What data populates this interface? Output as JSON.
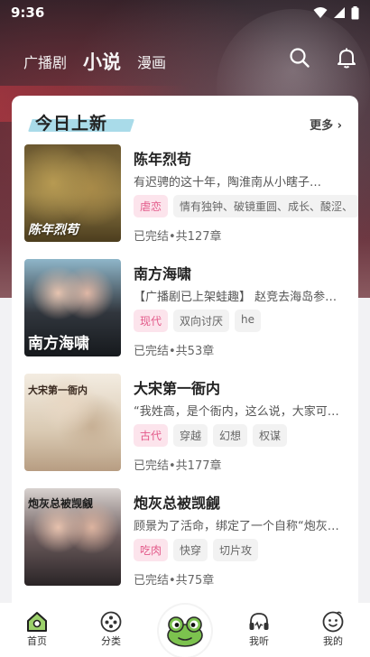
{
  "status_bar": {
    "time": "9:36"
  },
  "top_nav": {
    "tabs": [
      {
        "label": "广播剧",
        "active": false
      },
      {
        "label": "小说",
        "active": true
      },
      {
        "label": "漫画",
        "active": false
      }
    ],
    "icons": [
      "search-icon",
      "bell-icon"
    ]
  },
  "section": {
    "title": "今日上新",
    "more_label": "更多",
    "accent": "#a9dbe9"
  },
  "books": [
    {
      "title": "陈年烈苟",
      "description": "有迟骋的这十年，陶淮南从小瞎子…",
      "tags": [
        {
          "label": "虐恋",
          "highlight": true
        },
        {
          "label": "情有独钟、破镜重圆、成长、酸涩、",
          "highlight": false
        }
      ],
      "meta": "已完结•共127章",
      "cover_text": "陈年烈苟"
    },
    {
      "title": "南方海啸",
      "description": "【广播剧已上架蛙趣】 赵竞去海岛参…",
      "tags": [
        {
          "label": "现代",
          "highlight": true
        },
        {
          "label": "双向讨厌",
          "highlight": false
        },
        {
          "label": "he",
          "highlight": false
        }
      ],
      "meta": "已完结•共53章",
      "cover_text": "南方海啸"
    },
    {
      "title": "大宋第一衙内",
      "description": "“我姓高，是个衙内，这么说，大家可…",
      "tags": [
        {
          "label": "古代",
          "highlight": true
        },
        {
          "label": "穿越",
          "highlight": false
        },
        {
          "label": "幻想",
          "highlight": false
        },
        {
          "label": "权谋",
          "highlight": false
        }
      ],
      "meta": "已完结•共177章",
      "cover_text": "大宋第一衙内"
    },
    {
      "title": "炮灰总被觊觎",
      "description": "顾景为了活命，绑定了一个自称“炮灰…",
      "tags": [
        {
          "label": "吃肉",
          "highlight": true
        },
        {
          "label": "快穿",
          "highlight": false
        },
        {
          "label": "切片攻",
          "highlight": false
        }
      ],
      "meta": "已完结•共75章",
      "cover_text": "炮灰总被觊觎"
    }
  ],
  "bottom_nav": {
    "items": [
      {
        "label": "首页",
        "icon": "home-icon",
        "active": true
      },
      {
        "label": "分类",
        "icon": "category-icon",
        "active": false
      },
      {
        "label": "",
        "icon": "frog-icon",
        "active": false
      },
      {
        "label": "我听",
        "icon": "listen-icon",
        "active": false
      },
      {
        "label": "我的",
        "icon": "profile-icon",
        "active": false
      }
    ]
  }
}
